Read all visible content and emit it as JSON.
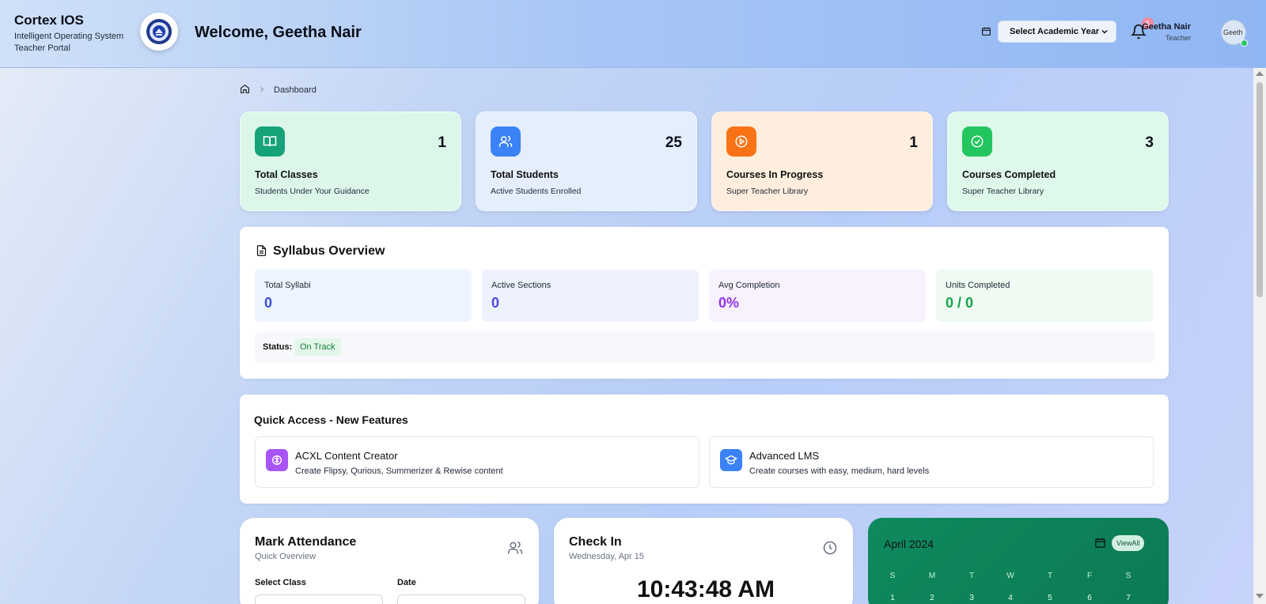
{
  "header": {
    "brand_title": "Cortex IOS",
    "brand_line1": "Intelligent Operating System",
    "brand_line2": "Teacher Portal",
    "welcome": "Welcome, Geetha Nair",
    "year_select": "Select Academic Year",
    "notification_count": "5",
    "user_name": "Geetha Nair",
    "user_role": "Teacher",
    "avatar_alt": "Geeth"
  },
  "breadcrumb": {
    "current": "Dashboard"
  },
  "stats": [
    {
      "value": "1",
      "title": "Total Classes",
      "sub": "Students Under Your Guidance",
      "icon": "book-icon",
      "bg": "#dcf7ea",
      "icon_color": "#16a37a"
    },
    {
      "value": "25",
      "title": "Total Students",
      "sub": "Active Students Enrolled",
      "icon": "users-icon",
      "bg": "#e4eefc",
      "icon_color": "#3b82f6"
    },
    {
      "value": "1",
      "title": "Courses In Progress",
      "sub": "Super Teacher Library",
      "icon": "play-circle-icon",
      "bg": "#ffeedd",
      "icon_color": "#f97316"
    },
    {
      "value": "3",
      "title": "Courses Completed",
      "sub": "Super Teacher Library",
      "icon": "check-circle-icon",
      "bg": "#def8ea",
      "icon_color": "#22c55e"
    }
  ],
  "syllabus": {
    "title": "Syllabus Overview",
    "metrics": [
      {
        "label": "Total Syllabi",
        "value": "0",
        "color": "#3b4fd1",
        "bg": "#eef4fe"
      },
      {
        "label": "Active Sections",
        "value": "0",
        "color": "#4f46e5",
        "bg": "#eef2fe"
      },
      {
        "label": "Avg Completion",
        "value": "0%",
        "color": "#9333ea",
        "bg": "#f7f2fe"
      },
      {
        "label": "Units Completed",
        "value": "0 / 0",
        "color": "#16a34a",
        "bg": "#eefaf2"
      }
    ],
    "status_label": "Status:",
    "status_value": "On Track"
  },
  "quick_access": {
    "title": "Quick Access - New Features",
    "items": [
      {
        "name": "ACXL Content Creator",
        "desc": "Create Flipsy, Qurious, Summerizer & Rewise content",
        "icon": "brain-icon",
        "color": "#a855f7"
      },
      {
        "name": "Advanced LMS",
        "desc": "Create courses with easy, medium, hard levels",
        "icon": "graduation-cap-icon",
        "color": "#3b82f6"
      }
    ]
  },
  "attendance": {
    "title": "Mark Attendance",
    "sub": "Quick Overview",
    "class_label": "Select Class",
    "date_label": "Date"
  },
  "checkin": {
    "title": "Check In",
    "date": "Wednesday, Apr 15",
    "time": "10:43:48 AM"
  },
  "calendar": {
    "month": "April 2024",
    "view_all": "ViewAll",
    "dow": [
      "S",
      "M",
      "T",
      "W",
      "T",
      "F",
      "S"
    ],
    "days": [
      "1",
      "2",
      "3",
      "4",
      "5",
      "6",
      "7"
    ]
  }
}
